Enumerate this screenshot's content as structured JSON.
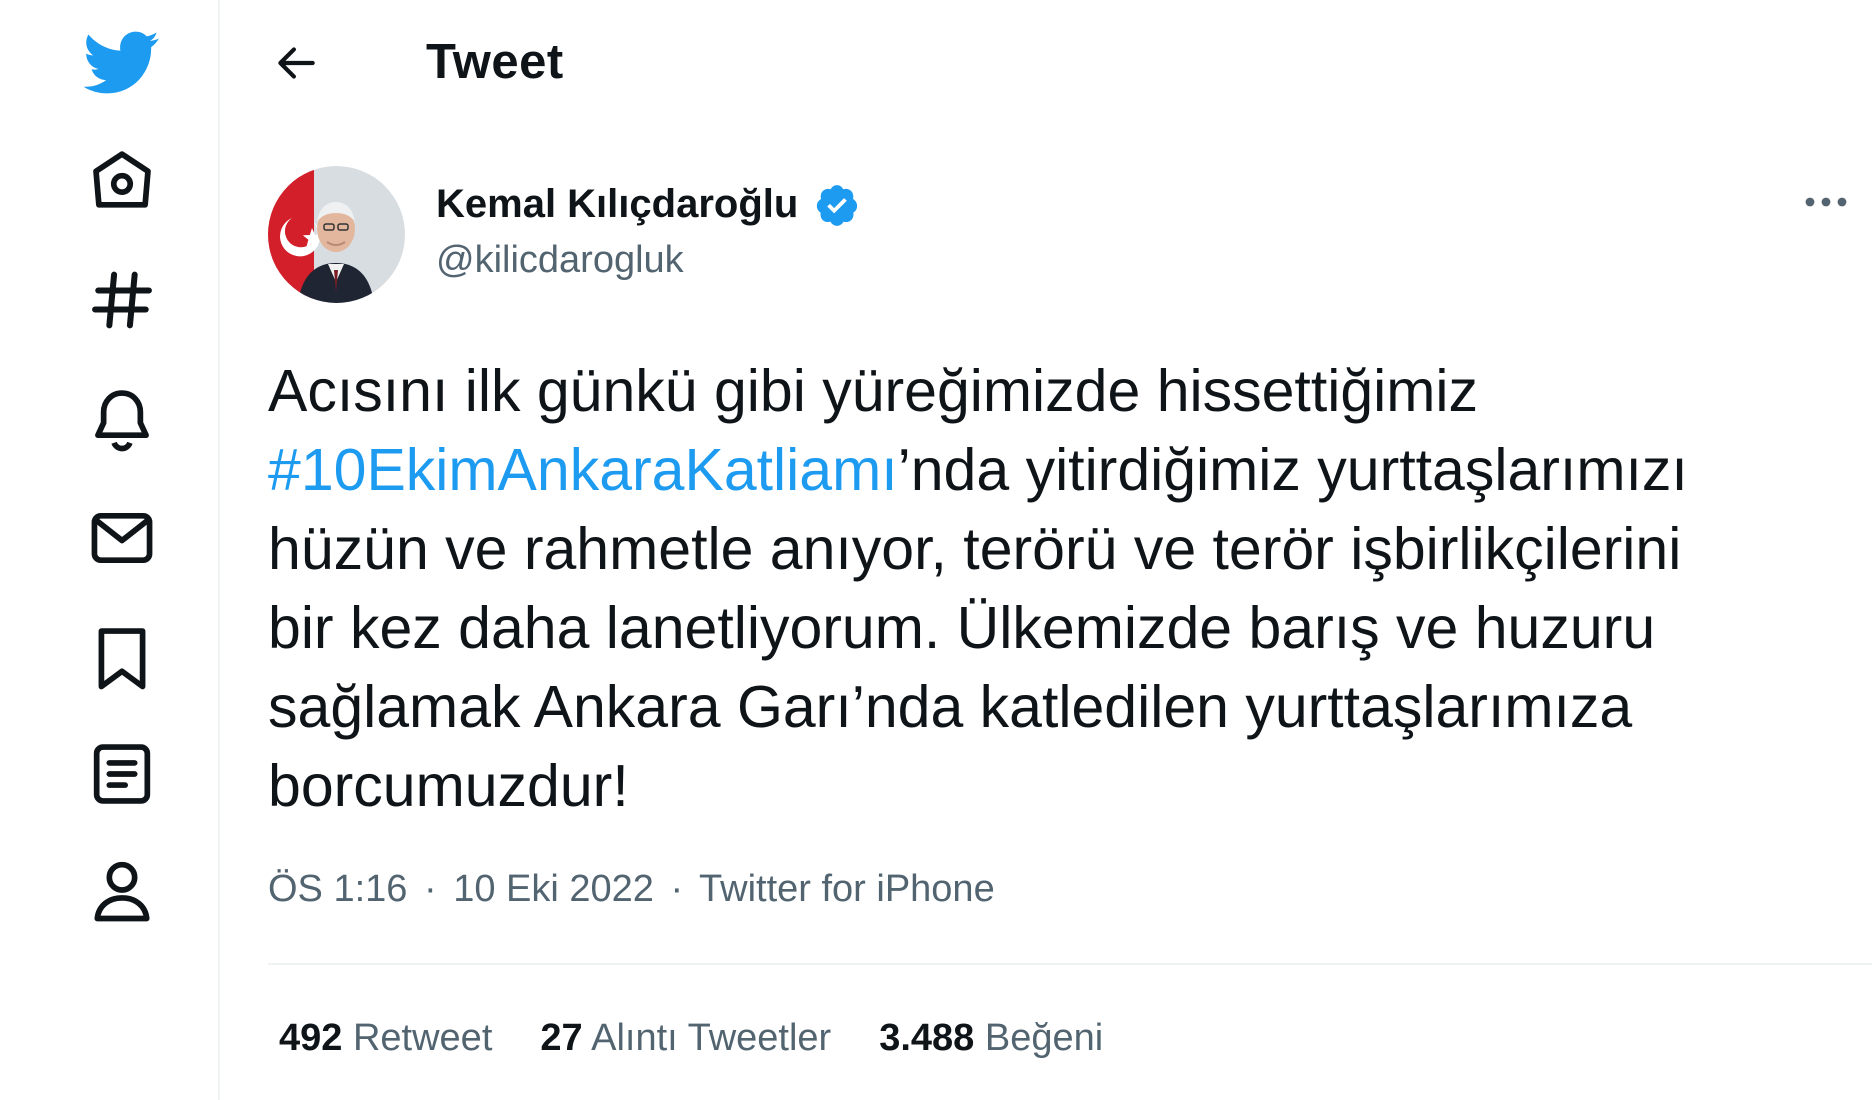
{
  "header": {
    "title": "Tweet"
  },
  "sidebar": {
    "items": [
      {
        "name": "twitter-logo",
        "icon": "twitter-bird-icon"
      },
      {
        "name": "home",
        "icon": "home-icon"
      },
      {
        "name": "explore",
        "icon": "hashtag-icon"
      },
      {
        "name": "notifications",
        "icon": "bell-icon"
      },
      {
        "name": "messages",
        "icon": "envelope-icon"
      },
      {
        "name": "bookmarks",
        "icon": "bookmark-icon"
      },
      {
        "name": "lists",
        "icon": "list-icon"
      },
      {
        "name": "profile",
        "icon": "profile-icon"
      }
    ]
  },
  "tweet": {
    "author": {
      "name": "Kemal Kılıçdaroğlu",
      "handle": "@kilicdarogluk",
      "verified": true
    },
    "text": {
      "line1": "Acısını ilk günkü gibi yüreğimizde hissettiğimiz",
      "hashtag": "#10EkimAnkaraKatliamı",
      "line2_rest": "’nda yitirdiğimiz yurttaşlarımızı",
      "line3": "hüzün ve rahmetle anıyor, terörü ve terör işbirlikçilerini",
      "line4": "bir kez daha lanetliyorum. Ülkemizde barış ve huzuru",
      "line5": "sağlamak Ankara Garı’nda katledilen yurttaşlarımıza",
      "line6": "borcumuzdur!"
    },
    "meta": {
      "time": "ÖS 1:16",
      "date": "10 Eki 2022",
      "source": "Twitter for iPhone",
      "separator": "·"
    },
    "stats": {
      "retweets": {
        "count": "492",
        "label": "Retweet"
      },
      "quotes": {
        "count": "27",
        "label": "Alıntı Tweetler"
      },
      "likes": {
        "count": "3.488",
        "label": "Beğeni"
      }
    }
  },
  "colors": {
    "accent": "#1d9bf0",
    "text": "#0f1419",
    "secondary": "#536471",
    "border": "#eff3f4"
  }
}
